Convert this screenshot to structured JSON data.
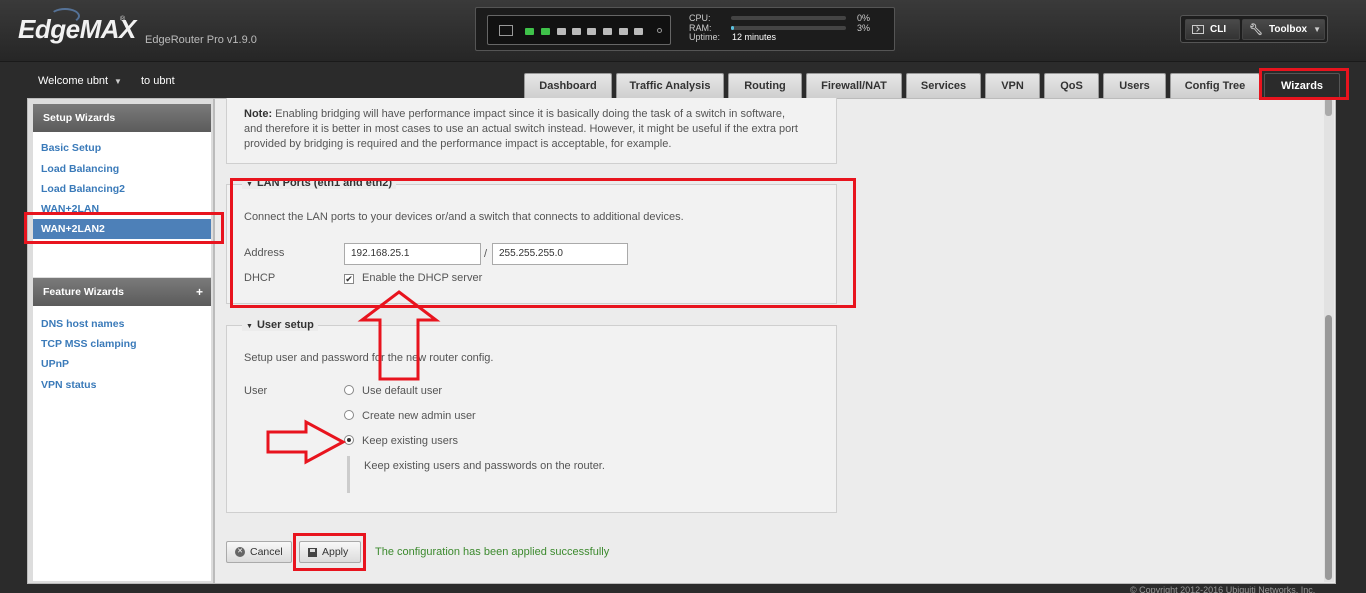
{
  "header": {
    "logo": "EdgeMAX",
    "logo_tm": "®",
    "product": "EdgeRouter Pro v1.9.0",
    "stats": {
      "cpu_label": "CPU:",
      "cpu_value": "0%",
      "cpu_percent": 0,
      "ram_label": "RAM:",
      "ram_value": "3%",
      "ram_percent": 3,
      "uptime_label": "Uptime:",
      "uptime_value": "12 minutes"
    },
    "cli_label": "CLI",
    "toolbox_label": "Toolbox"
  },
  "user": {
    "welcome": "Welcome ubnt",
    "switch_to": "to ubnt"
  },
  "tabs": [
    {
      "label": "Dashboard"
    },
    {
      "label": "Traffic Analysis"
    },
    {
      "label": "Routing"
    },
    {
      "label": "Firewall/NAT"
    },
    {
      "label": "Services"
    },
    {
      "label": "VPN"
    },
    {
      "label": "QoS"
    },
    {
      "label": "Users"
    },
    {
      "label": "Config Tree"
    },
    {
      "label": "Wizards"
    }
  ],
  "active_tab": "Wizards",
  "sidebar": {
    "setup_title": "Setup Wizards",
    "setup_items": [
      {
        "label": "Basic Setup"
      },
      {
        "label": "Load Balancing"
      },
      {
        "label": "Load Balancing2"
      },
      {
        "label": "WAN+2LAN"
      },
      {
        "label": "WAN+2LAN2"
      }
    ],
    "active_item": "WAN+2LAN2",
    "feature_title": "Feature Wizards",
    "feature_plus": "+",
    "feature_items": [
      {
        "label": "DNS host names"
      },
      {
        "label": "TCP MSS clamping"
      },
      {
        "label": "UPnP"
      },
      {
        "label": "VPN status"
      }
    ]
  },
  "note": {
    "label": "Note:",
    "line1": "Enabling bridging will have performance impact since it is basically doing the task of a switch in software,",
    "line2": "and therefore it is better in most cases to use an actual switch instead. However, it might be useful if the extra port",
    "line3": "provided by bridging is required and the performance impact is acceptable, for example."
  },
  "lan_ports": {
    "legend": "LAN Ports (eth1 and eth2)",
    "description": "Connect the LAN ports to your devices or/and a switch that connects to additional devices.",
    "address_label": "Address",
    "address_value": "192.168.25.1",
    "separator": "/",
    "netmask_value": "255.255.255.0",
    "dhcp_label": "DHCP",
    "dhcp_checked": true,
    "dhcp_option": "Enable the DHCP server"
  },
  "user_setup": {
    "legend": "User setup",
    "description": "Setup user and password for the new router config.",
    "user_label": "User",
    "options": [
      {
        "label": "Use default user",
        "selected": false
      },
      {
        "label": "Create new admin user",
        "selected": false
      },
      {
        "label": "Keep existing users",
        "selected": true
      }
    ],
    "hint": "Keep existing users and passwords on the router."
  },
  "actions": {
    "cancel_label": "Cancel",
    "apply_label": "Apply",
    "success_message": "The configuration has been applied successfully"
  },
  "footer": {
    "copyright": "© Copyright 2012-2016 Ubiquiti Networks, Inc."
  },
  "colors": {
    "highlight": "#e8141e",
    "link": "#3a7ab9",
    "active_nav": "#4d80b8",
    "success": "#3c8a2e",
    "port_up": "#3fc24a"
  }
}
